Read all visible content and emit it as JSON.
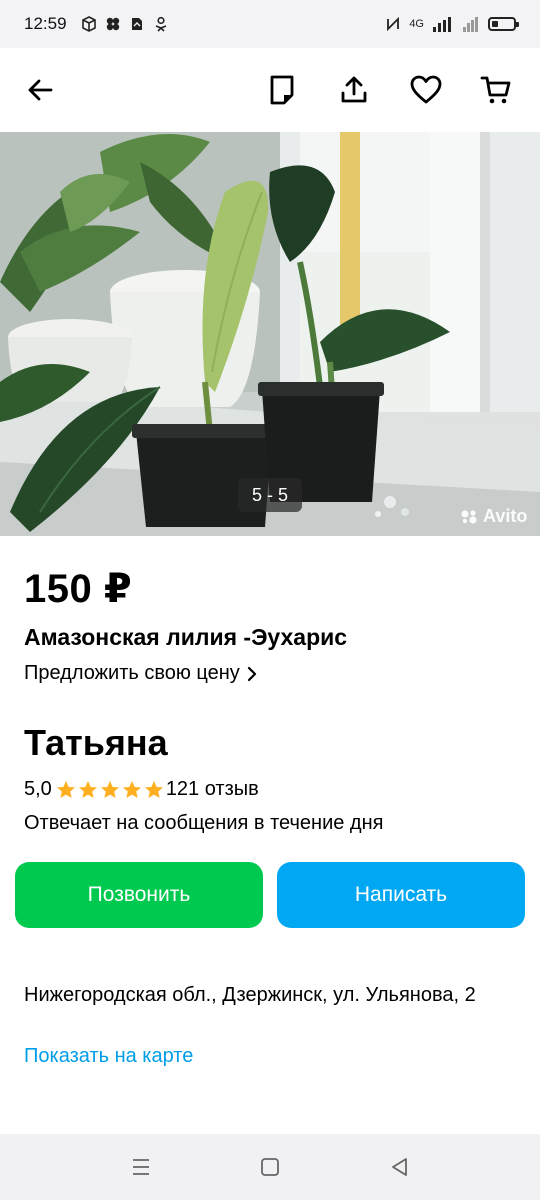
{
  "status_bar": {
    "time": "12:59",
    "network": "4G",
    "icons": [
      "box-icon",
      "flower-icon",
      "doc-icon",
      "person-icon",
      "nfc-icon",
      "signal-icon",
      "battery-icon"
    ]
  },
  "toolbar": {
    "icons": [
      "back-arrow-icon",
      "note-icon",
      "share-icon",
      "heart-icon",
      "cart-icon"
    ]
  },
  "photo": {
    "counter": "5 - 5",
    "watermark": "Avito"
  },
  "listing": {
    "price": "150 ₽",
    "title": "Амазонская лилия -Эухарис",
    "offer_price": "Предложить свою цену"
  },
  "seller": {
    "name": "Татьяна",
    "rating": "5,0",
    "stars": 5,
    "reviews": "121 отзыв",
    "responds": "Отвечает на сообщения в течение дня"
  },
  "actions": {
    "call": "Позвонить",
    "write": "Написать"
  },
  "location": {
    "address": "Нижегородская обл., Дзержинск, ул. Ульянова, 2",
    "map_link": "Показать на карте"
  },
  "colors": {
    "call_button": "#00c950",
    "write_button": "#00a8f4",
    "link": "#009ee8",
    "star": "#ffb021"
  }
}
